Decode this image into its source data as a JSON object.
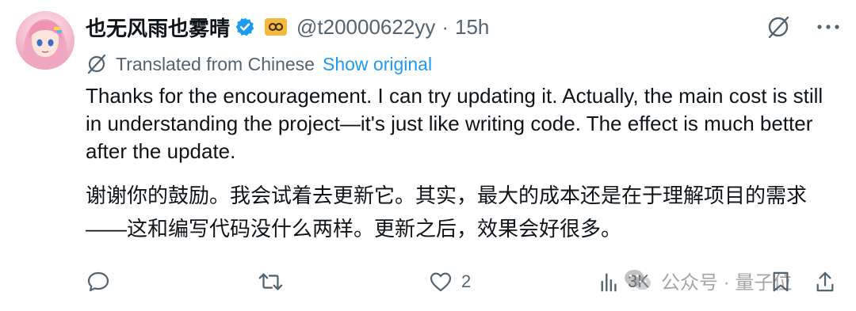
{
  "user": {
    "display_name": "也无风雨也雾晴",
    "handle": "@t20000622yy",
    "separator": "·",
    "time": "15h"
  },
  "translation": {
    "label": "Translated from Chinese",
    "show_original": "Show original"
  },
  "post": {
    "text_en": "Thanks for the encouragement. I can try updating it. Actually, the main cost is still in understanding the project—it's just like writing code. The effect is much better after the update.",
    "text_zh": "谢谢你的鼓励。我会试着去更新它。其实，最大的成本还是在于理解项目的需求——这和编写代码没什么两样。更新之后，效果会好很多。"
  },
  "actions": {
    "reply_count": "",
    "repost_count": "",
    "like_count": "2",
    "views_count": "3K"
  },
  "watermark": {
    "text": "公众号 · 量子位"
  },
  "icons": [
    "verified-badge-icon",
    "affiliate-badge-icon",
    "grok-icon",
    "more-icon",
    "translate-icon",
    "reply-icon",
    "repost-icon",
    "like-icon",
    "views-icon",
    "bookmark-icon",
    "share-icon",
    "wechat-icon"
  ],
  "colors": {
    "text": "#0f1419",
    "secondary": "#536471",
    "link": "#1d9bf0",
    "verified": "#1d9bf0",
    "affiliate": "#f4b740"
  }
}
